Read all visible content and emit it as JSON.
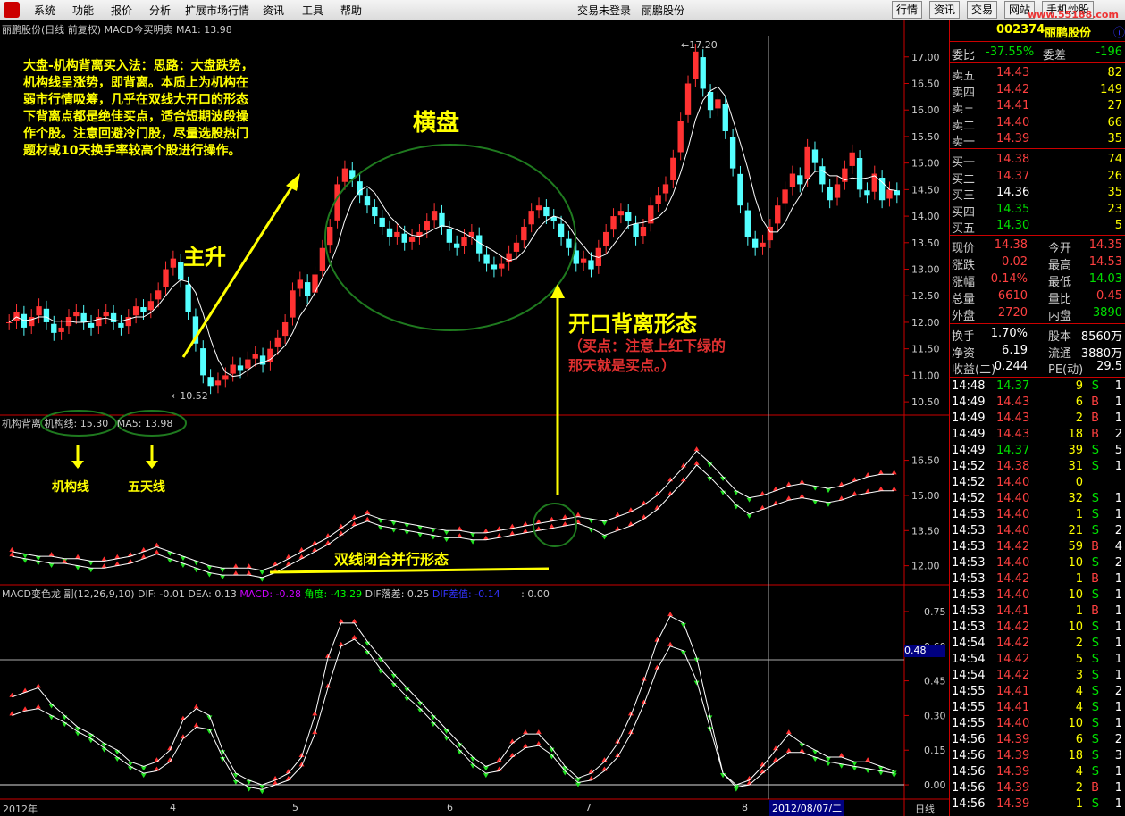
{
  "menu": [
    "系统",
    "功能",
    "报价",
    "分析",
    "扩展市场行情",
    "资讯",
    "工具",
    "帮助"
  ],
  "status": {
    "login": "交易未登录",
    "stock": "丽鹏股份"
  },
  "right_tabs": [
    "行情",
    "资讯",
    "交易",
    "网站",
    "手机炒股"
  ],
  "watermark": "www.55188.com",
  "main_header": "丽鹏股份(日线 前复权) MACD今买明卖 MA1: 13.98",
  "ind1_header": {
    "name": "机构背离",
    "jigou": "机构线: 15.30",
    "ma5": "MA5: 13.98"
  },
  "ind2_header": {
    "name": "MACD变色龙 副(12,26,9,10)",
    "dif": "DIF: -0.01",
    "dea": "DEA: 0.13",
    "macd": "MACD: -0.28",
    "angle": "角度: -43.29",
    "dif_drop": "DIF落差: 0.25",
    "dif_diff": "DIF差值: -0.14",
    "tail": ": 0.00"
  },
  "annot": {
    "method": "大盘-机构背离买入法：思路：大盘跌势，机构线呈涨势，即背离。本质上为机构在弱市行情吸筹，几乎在双线大开口的形态下背离点都是绝佳买点，适合短期波段操作个股。注意回避冷门股，尽量选股热门题材或10天换手率较高个股进行操作。",
    "hengpan": "横盘",
    "zhusheng": "主升",
    "kaikou": "开口背离形态",
    "buy_note": "（买点：注意上红下绿的那天就是买点。）",
    "jigouxian": "机构线",
    "wutianxian": "五天线",
    "shuangxian": "双线闭合并行形态",
    "high": "17.20",
    "low": "10.52"
  },
  "price_axis": [
    "17.00",
    "16.50",
    "16.00",
    "15.50",
    "15.00",
    "14.50",
    "14.00",
    "13.50",
    "13.00",
    "12.50",
    "12.00",
    "11.50",
    "11.00",
    "10.50"
  ],
  "ind1_axis": [
    "16.50",
    "15.00",
    "13.50",
    "12.00"
  ],
  "ind2_axis": [
    "0.75",
    "0.60",
    "0.45",
    "0.30",
    "0.15",
    "0.00"
  ],
  "ind2_marker": "0.48",
  "time_axis": {
    "labels": [
      "2012年",
      "4",
      "5",
      "6",
      "7",
      "8"
    ],
    "date": "2012/08/07/二",
    "period": "日线"
  },
  "quote": {
    "code": "002374",
    "name": "丽鹏股份",
    "weibi_label": "委比",
    "weibi": "-37.55%",
    "weicha_label": "委差",
    "weicha": "-196",
    "asks": [
      [
        "卖五",
        "14.43",
        "82"
      ],
      [
        "卖四",
        "14.42",
        "149"
      ],
      [
        "卖三",
        "14.41",
        "27"
      ],
      [
        "卖二",
        "14.40",
        "66"
      ],
      [
        "卖一",
        "14.39",
        "35"
      ]
    ],
    "bids": [
      [
        "买一",
        "14.38",
        "74"
      ],
      [
        "买二",
        "14.37",
        "26"
      ],
      [
        "买三",
        "14.36",
        "35"
      ],
      [
        "买四",
        "14.35",
        "23"
      ],
      [
        "买五",
        "14.30",
        "5"
      ]
    ],
    "stats": [
      [
        "现价",
        "14.38",
        "今开",
        "14.35"
      ],
      [
        "涨跌",
        "0.02",
        "最高",
        "14.53"
      ],
      [
        "涨幅",
        "0.14%",
        "最低",
        "14.03"
      ],
      [
        "总量",
        "6610",
        "量比",
        "0.45"
      ],
      [
        "外盘",
        "2720",
        "内盘",
        "3890"
      ]
    ],
    "fin": [
      [
        "换手",
        "1.70%",
        "股本",
        "8560万"
      ],
      [
        "净资",
        "6.19",
        "流通",
        "3880万"
      ],
      [
        "收益(二)",
        "0.244",
        "PE(动)",
        "29.5"
      ]
    ],
    "ticks": [
      [
        "14:48",
        "14.37",
        "9",
        "S",
        "1"
      ],
      [
        "14:49",
        "14.43",
        "6",
        "B",
        "1"
      ],
      [
        "14:49",
        "14.43",
        "2",
        "B",
        "1"
      ],
      [
        "14:49",
        "14.43",
        "18",
        "B",
        "2"
      ],
      [
        "14:49",
        "14.37",
        "39",
        "S",
        "5"
      ],
      [
        "14:52",
        "14.38",
        "31",
        "S",
        "1"
      ],
      [
        "14:52",
        "14.40",
        "0",
        "",
        ""
      ],
      [
        "14:52",
        "14.40",
        "32",
        "S",
        "1"
      ],
      [
        "14:53",
        "14.40",
        "1",
        "S",
        "1"
      ],
      [
        "14:53",
        "14.40",
        "21",
        "S",
        "2"
      ],
      [
        "14:53",
        "14.42",
        "59",
        "B",
        "4"
      ],
      [
        "14:53",
        "14.40",
        "10",
        "S",
        "2"
      ],
      [
        "14:53",
        "14.42",
        "1",
        "B",
        "1"
      ],
      [
        "14:53",
        "14.40",
        "10",
        "S",
        "1"
      ],
      [
        "14:53",
        "14.41",
        "1",
        "B",
        "1"
      ],
      [
        "14:53",
        "14.42",
        "10",
        "S",
        "1"
      ],
      [
        "14:54",
        "14.42",
        "2",
        "S",
        "1"
      ],
      [
        "14:54",
        "14.42",
        "5",
        "S",
        "1"
      ],
      [
        "14:54",
        "14.42",
        "3",
        "S",
        "1"
      ],
      [
        "14:55",
        "14.41",
        "4",
        "S",
        "2"
      ],
      [
        "14:55",
        "14.41",
        "4",
        "S",
        "1"
      ],
      [
        "14:55",
        "14.40",
        "10",
        "S",
        "1"
      ],
      [
        "14:56",
        "14.39",
        "6",
        "S",
        "2"
      ],
      [
        "14:56",
        "14.39",
        "18",
        "S",
        "3"
      ],
      [
        "14:56",
        "14.39",
        "4",
        "S",
        "1"
      ],
      [
        "14:56",
        "14.39",
        "2",
        "B",
        "1"
      ],
      [
        "14:56",
        "14.39",
        "1",
        "S",
        "1"
      ]
    ]
  },
  "chart_data": {
    "type": "candlestick",
    "price_range": [
      10.3,
      17.4
    ],
    "closes": [
      12.0,
      12.2,
      11.9,
      12.1,
      12.3,
      12.0,
      11.8,
      11.9,
      12.1,
      12.2,
      12.0,
      11.9,
      12.1,
      12.2,
      12.0,
      11.9,
      12.1,
      12.3,
      12.2,
      12.4,
      12.6,
      13.0,
      13.2,
      12.8,
      12.2,
      11.6,
      11.0,
      10.8,
      10.9,
      11.0,
      11.2,
      11.1,
      11.3,
      11.4,
      11.2,
      11.5,
      11.7,
      12.0,
      12.6,
      12.8,
      12.5,
      12.9,
      13.4,
      13.8,
      14.6,
      14.9,
      14.7,
      14.4,
      14.2,
      14.0,
      13.8,
      13.6,
      13.7,
      13.5,
      13.6,
      13.7,
      13.9,
      14.1,
      13.8,
      13.5,
      13.4,
      13.6,
      13.7,
      13.3,
      13.1,
      13.0,
      13.1,
      13.3,
      13.5,
      13.8,
      14.1,
      14.2,
      14.0,
      13.9,
      13.6,
      13.4,
      13.1,
      13.2,
      13.0,
      13.4,
      13.7,
      14.0,
      14.1,
      13.9,
      13.6,
      13.8,
      14.2,
      14.4,
      14.6,
      15.1,
      15.8,
      16.5,
      17.1,
      16.4,
      16.0,
      16.2,
      15.6,
      14.9,
      14.2,
      13.6,
      13.4,
      13.5,
      13.8,
      14.2,
      14.5,
      14.8,
      14.6,
      15.3,
      15.0,
      14.6,
      14.3,
      14.6,
      14.9,
      15.2,
      14.5,
      14.4,
      14.8,
      14.3,
      14.5,
      14.4
    ],
    "ind1_jigou": [
      12.6,
      12.5,
      12.4,
      12.4,
      12.3,
      12.3,
      12.2,
      12.2,
      12.3,
      12.4,
      12.6,
      12.8,
      12.6,
      12.4,
      12.2,
      12.0,
      11.9,
      11.9,
      11.9,
      11.8,
      12.0,
      12.3,
      12.6,
      12.9,
      13.2,
      13.6,
      14.0,
      14.2,
      14.0,
      13.9,
      13.8,
      13.7,
      13.6,
      13.5,
      13.5,
      13.4,
      13.4,
      13.5,
      13.6,
      13.7,
      13.8,
      13.9,
      14.0,
      14.1,
      14.0,
      13.9,
      14.1,
      14.3,
      14.6,
      15.0,
      15.6,
      16.2,
      16.9,
      16.4,
      15.8,
      15.2,
      14.9,
      15.0,
      15.2,
      15.4,
      15.5,
      15.4,
      15.3,
      15.4,
      15.6,
      15.8,
      15.9,
      15.9
    ],
    "ind1_ma5": [
      12.4,
      12.3,
      12.2,
      12.1,
      12.1,
      12.0,
      11.9,
      11.9,
      12.0,
      12.1,
      12.3,
      12.5,
      12.3,
      12.1,
      11.9,
      11.7,
      11.6,
      11.6,
      11.6,
      11.5,
      11.7,
      12.0,
      12.3,
      12.6,
      12.9,
      13.3,
      13.7,
      13.9,
      13.7,
      13.6,
      13.5,
      13.4,
      13.3,
      13.2,
      13.2,
      13.1,
      13.1,
      13.2,
      13.3,
      13.4,
      13.5,
      13.6,
      13.7,
      13.8,
      13.6,
      13.3,
      13.5,
      13.7,
      14.0,
      14.4,
      15.0,
      15.6,
      16.3,
      15.8,
      15.2,
      14.6,
      14.2,
      14.4,
      14.6,
      14.8,
      14.9,
      14.8,
      14.7,
      14.8,
      15.0,
      15.1,
      15.2,
      15.2
    ],
    "ind2_dif": [
      0.38,
      0.4,
      0.42,
      0.35,
      0.3,
      0.25,
      0.22,
      0.18,
      0.15,
      0.1,
      0.08,
      0.1,
      0.15,
      0.28,
      0.33,
      0.3,
      0.15,
      0.05,
      0.02,
      0.0,
      0.02,
      0.05,
      0.12,
      0.3,
      0.55,
      0.7,
      0.7,
      0.62,
      0.55,
      0.48,
      0.42,
      0.36,
      0.3,
      0.24,
      0.18,
      0.12,
      0.08,
      0.1,
      0.18,
      0.22,
      0.22,
      0.16,
      0.08,
      0.03,
      0.05,
      0.1,
      0.18,
      0.3,
      0.45,
      0.62,
      0.73,
      0.7,
      0.55,
      0.3,
      0.05,
      0.0,
      0.02,
      0.08,
      0.15,
      0.22,
      0.18,
      0.15,
      0.12,
      0.12,
      0.1,
      0.1,
      0.08,
      0.06
    ],
    "ind2_dea": [
      0.3,
      0.32,
      0.33,
      0.3,
      0.27,
      0.23,
      0.2,
      0.16,
      0.12,
      0.08,
      0.05,
      0.06,
      0.1,
      0.2,
      0.25,
      0.24,
      0.12,
      0.02,
      -0.01,
      -0.02,
      0.0,
      0.02,
      0.08,
      0.22,
      0.42,
      0.6,
      0.63,
      0.58,
      0.5,
      0.44,
      0.38,
      0.33,
      0.27,
      0.21,
      0.15,
      0.09,
      0.05,
      0.06,
      0.12,
      0.16,
      0.17,
      0.13,
      0.06,
      0.01,
      0.02,
      0.06,
      0.12,
      0.22,
      0.35,
      0.5,
      0.6,
      0.58,
      0.45,
      0.25,
      0.05,
      -0.01,
      0.0,
      0.05,
      0.1,
      0.14,
      0.14,
      0.12,
      0.1,
      0.09,
      0.08,
      0.07,
      0.06,
      0.05
    ],
    "ind1_range": [
      11.3,
      17.4
    ],
    "ind2_range": [
      -0.05,
      0.8
    ]
  }
}
